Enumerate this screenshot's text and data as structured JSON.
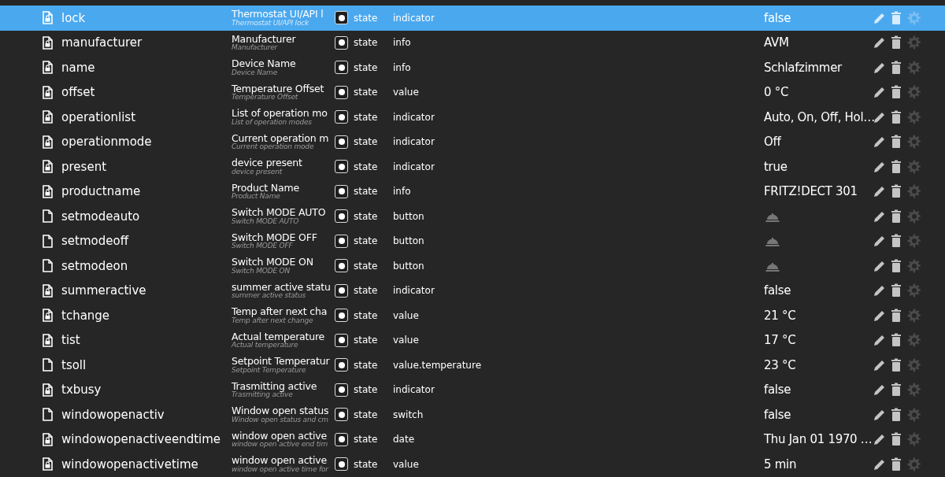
{
  "rows": [
    {
      "id": "lock",
      "locked": true,
      "selected": true,
      "title": "Thermostat UI/API l",
      "desc": "Thermostat UI/API lock",
      "type": "state",
      "role": "indicator",
      "kind": "text",
      "value": "false"
    },
    {
      "id": "manufacturer",
      "locked": true,
      "selected": false,
      "title": "Manufacturer",
      "desc": "Manufacturer",
      "type": "state",
      "role": "info",
      "kind": "text",
      "value": "AVM"
    },
    {
      "id": "name",
      "locked": true,
      "selected": false,
      "title": "Device Name",
      "desc": "Device Name",
      "type": "state",
      "role": "info",
      "kind": "text",
      "value": "Schlafzimmer"
    },
    {
      "id": "offset",
      "locked": true,
      "selected": false,
      "title": "Temperature Offset",
      "desc": "Temperature Offset",
      "type": "state",
      "role": "value",
      "kind": "text",
      "value": "0 °C"
    },
    {
      "id": "operationlist",
      "locked": true,
      "selected": false,
      "title": "List of operation mo",
      "desc": "List of operation modes",
      "type": "state",
      "role": "indicator",
      "kind": "text",
      "value": "Auto, On, Off, Hol…"
    },
    {
      "id": "operationmode",
      "locked": true,
      "selected": false,
      "title": "Current operation m",
      "desc": "Current operation mode",
      "type": "state",
      "role": "indicator",
      "kind": "text",
      "value": "Off"
    },
    {
      "id": "present",
      "locked": true,
      "selected": false,
      "title": "device present",
      "desc": "device present",
      "type": "state",
      "role": "indicator",
      "kind": "text",
      "value": "true"
    },
    {
      "id": "productname",
      "locked": true,
      "selected": false,
      "title": "Product Name",
      "desc": "Product Name",
      "type": "state",
      "role": "info",
      "kind": "text",
      "value": "FRITZ!DECT 301"
    },
    {
      "id": "setmodeauto",
      "locked": false,
      "selected": false,
      "title": "Switch MODE AUTO",
      "desc": "Switch MODE AUTO",
      "type": "state",
      "role": "button",
      "kind": "bell"
    },
    {
      "id": "setmodeoff",
      "locked": false,
      "selected": false,
      "title": "Switch MODE OFF",
      "desc": "Switch MODE OFF",
      "type": "state",
      "role": "button",
      "kind": "bell"
    },
    {
      "id": "setmodeon",
      "locked": false,
      "selected": false,
      "title": "Switch MODE ON",
      "desc": "Switch MODE ON",
      "type": "state",
      "role": "button",
      "kind": "bell"
    },
    {
      "id": "summeractive",
      "locked": true,
      "selected": false,
      "title": "summer active statu",
      "desc": "summer active status",
      "type": "state",
      "role": "indicator",
      "kind": "text",
      "value": "false"
    },
    {
      "id": "tchange",
      "locked": true,
      "selected": false,
      "title": "Temp after next cha",
      "desc": "Temp after next change",
      "type": "state",
      "role": "value",
      "kind": "text",
      "value": "21 °C"
    },
    {
      "id": "tist",
      "locked": true,
      "selected": false,
      "title": "Actual temperature",
      "desc": "Actual temperature",
      "type": "state",
      "role": "value",
      "kind": "text",
      "value": "17 °C"
    },
    {
      "id": "tsoll",
      "locked": false,
      "selected": false,
      "title": "Setpoint Temperatur",
      "desc": "Setpoint Temperature",
      "type": "state",
      "role": "value.temperature",
      "kind": "text",
      "value": "23 °C"
    },
    {
      "id": "txbusy",
      "locked": true,
      "selected": false,
      "title": "Trasmitting active",
      "desc": "Trasmitting active",
      "type": "state",
      "role": "indicator",
      "kind": "text",
      "value": "false"
    },
    {
      "id": "windowopenactiv",
      "locked": false,
      "selected": false,
      "title": "Window open status",
      "desc": "Window open status and cm",
      "type": "state",
      "role": "switch",
      "kind": "text",
      "value": "false"
    },
    {
      "id": "windowopenactiveendtime",
      "locked": true,
      "selected": false,
      "title": "window open active",
      "desc": "window open active end tim",
      "type": "state",
      "role": "date",
      "kind": "text",
      "value": "Thu Jan 01 1970 …"
    },
    {
      "id": "windowopenactivetime",
      "locked": true,
      "selected": false,
      "title": "window open active",
      "desc": "window open active time for",
      "type": "state",
      "role": "value",
      "kind": "text",
      "value": "5 min"
    }
  ]
}
